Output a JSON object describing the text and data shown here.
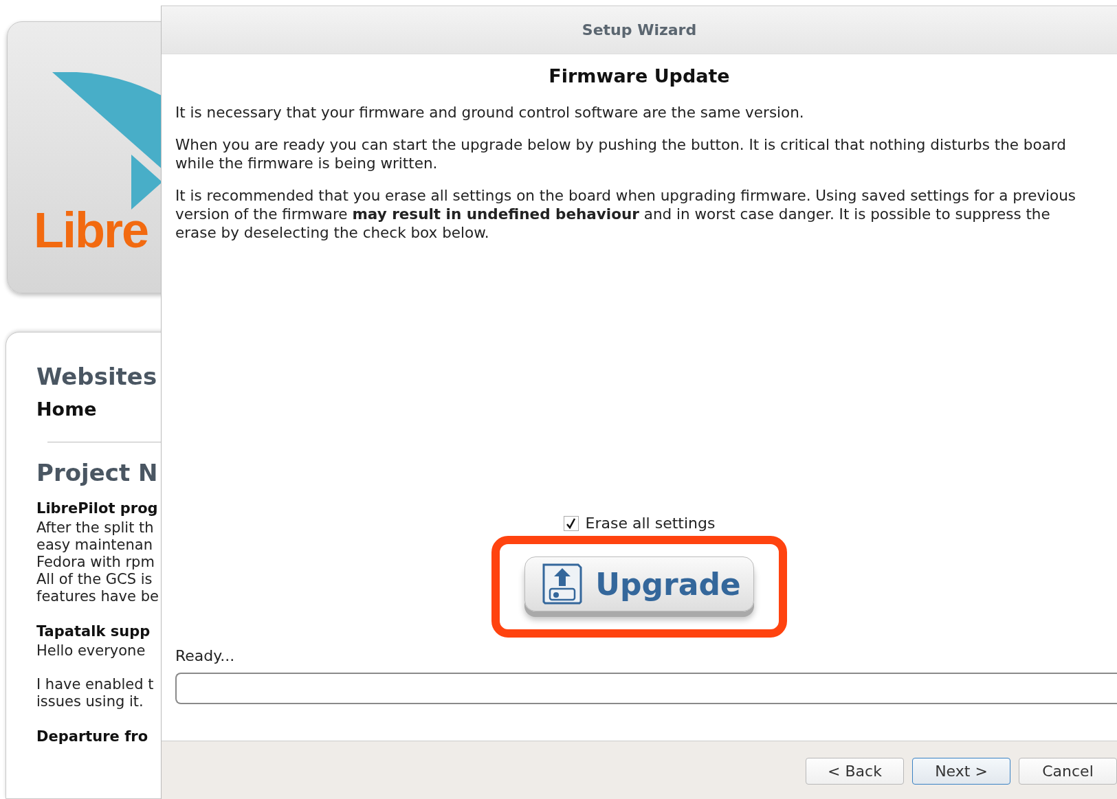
{
  "background_page": {
    "logo": {
      "text": "Libre"
    },
    "heading": "Websites",
    "nav": [
      "Home"
    ],
    "section_heading": "Project N",
    "posts": [
      {
        "title": "LibrePilot prog",
        "lines": [
          "After the split th",
          "easy maintenan",
          "Fedora with rpm",
          "All of the GCS is",
          "features have be"
        ]
      },
      {
        "title": "Tapatalk supp",
        "lines": [
          "Hello everyone"
        ],
        "lines_2": [
          "I have enabled t",
          "issues using it."
        ]
      },
      {
        "title": "Departure fro"
      }
    ]
  },
  "window": {
    "title": "Setup Wizard"
  },
  "page": {
    "title": "Firmware Update",
    "paragraphs": [
      "It is necessary that your firmware and ground control software are the same version.",
      "When you are ready you can start the upgrade below by pushing the button. It is critical that nothing disturbs the board while the firmware is being written.",
      "It is recommended that you erase all settings on the board when upgrading firmware. Using saved settings for a previous version of the firmware **may result in undefined behaviour** and in worst case danger. It is possible to suppress the erase by deselecting the check box below."
    ],
    "erase_checkbox": {
      "label": "Erase all settings",
      "checked": true
    },
    "upgrade_button": {
      "label": "Upgrade",
      "highlighted": true
    },
    "status": "Ready...",
    "progress": {
      "level": 0
    }
  },
  "buttons": [
    {
      "label": "< Back",
      "default": false
    },
    {
      "label": "Next >",
      "default": true
    },
    {
      "label": "Cancel",
      "default": false
    }
  ]
}
